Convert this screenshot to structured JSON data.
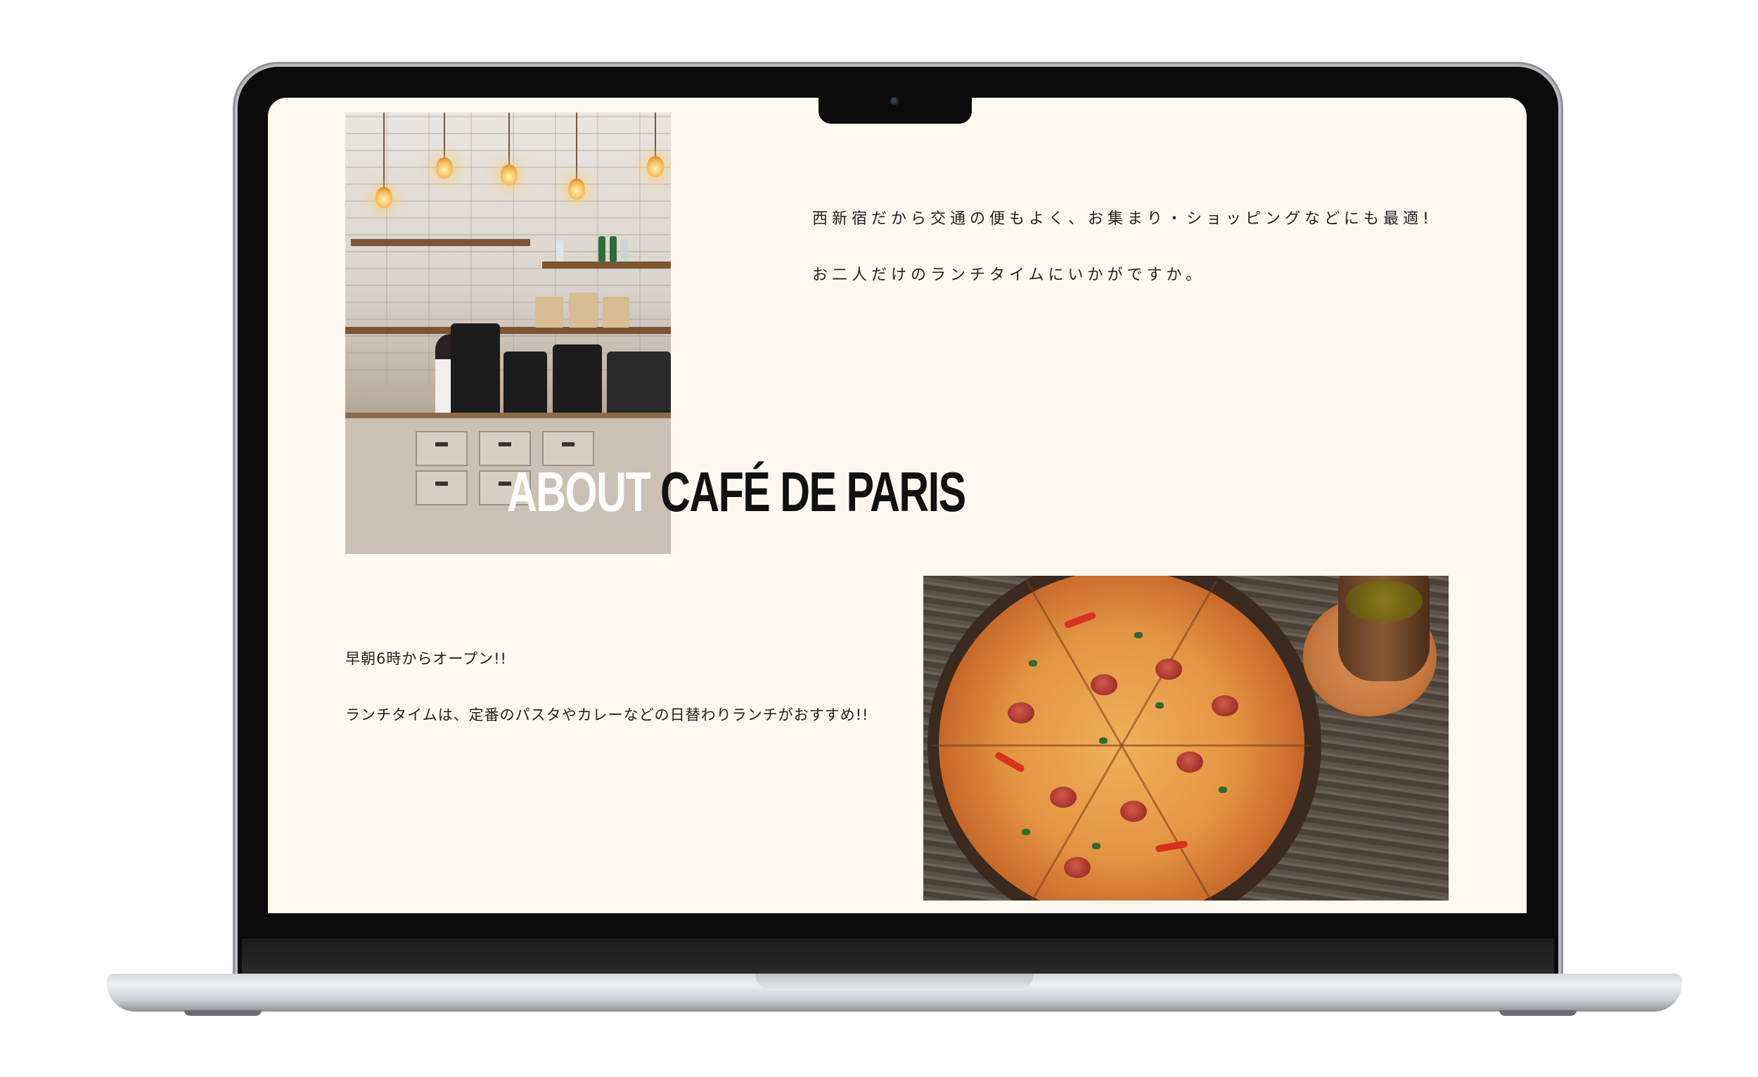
{
  "page": {
    "headline_word1": "ABOUT",
    "headline_word2": "CAFÉ DE PARIS",
    "intro_lines": [
      "西新宿だから交通の便もよく、お集まり・ショッピングなどにも最適!",
      "お二人だけのランチタイムにいかがですか。"
    ],
    "menu_lines": [
      "早朝6時からオープン!!",
      "ランチタイムは、定番のパスタやカレーなどの日替わりランチがおすすめ!!"
    ]
  },
  "colors": {
    "page_background": "#fdf8f0",
    "headline_light": "#ffffff",
    "headline_dark": "#111111",
    "laptop_bezel": "#0b0b0b"
  }
}
